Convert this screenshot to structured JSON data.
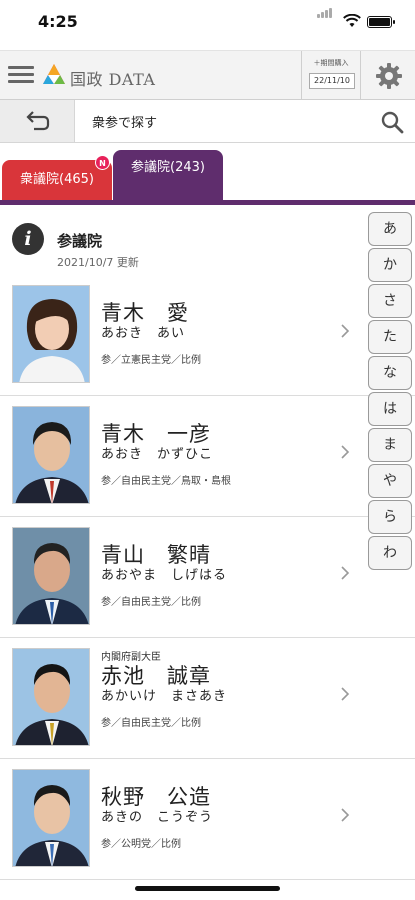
{
  "status_bar": {
    "time": "4:25"
  },
  "header": {
    "logo_text": "国政 DATA",
    "purchase_label": "＋期間購入",
    "purchase_date": "22/11/10"
  },
  "search": {
    "placeholder": "衆参で探す"
  },
  "tabs": [
    {
      "label": "衆議院(465)",
      "badge": "N",
      "color": "#d9353a"
    },
    {
      "label": "参議院(243)",
      "color": "#5f2d6d"
    }
  ],
  "info": {
    "icon": "i",
    "title": "参議院",
    "updated": "2021/10/7 更新"
  },
  "members": [
    {
      "title": "",
      "name": "青木　愛",
      "kana": "あおき　あい",
      "meta": "参／立憲民主党／比例"
    },
    {
      "title": "",
      "name": "青木　一彦",
      "kana": "あおき　かずひこ",
      "meta": "参／自由民主党／鳥取・島根"
    },
    {
      "title": "",
      "name": "青山　繁晴",
      "kana": "あおやま　しげはる",
      "meta": "参／自由民主党／比例"
    },
    {
      "title": "内閣府副大臣",
      "name": "赤池　誠章",
      "kana": "あかいけ　まさあき",
      "meta": "参／自由民主党／比例"
    },
    {
      "title": "",
      "name": "秋野　公造",
      "kana": "あきの　こうぞう",
      "meta": "参／公明党／比例"
    }
  ],
  "index": [
    "あ",
    "か",
    "さ",
    "た",
    "な",
    "は",
    "ま",
    "や",
    "ら",
    "わ"
  ],
  "icons": {
    "menu": "hamburger-icon",
    "logo": "triangle-logo",
    "settings": "gear-icon",
    "back": "back-arrow-icon",
    "search": "search-icon",
    "info": "info-icon",
    "chevron": "chevron-right-icon"
  }
}
